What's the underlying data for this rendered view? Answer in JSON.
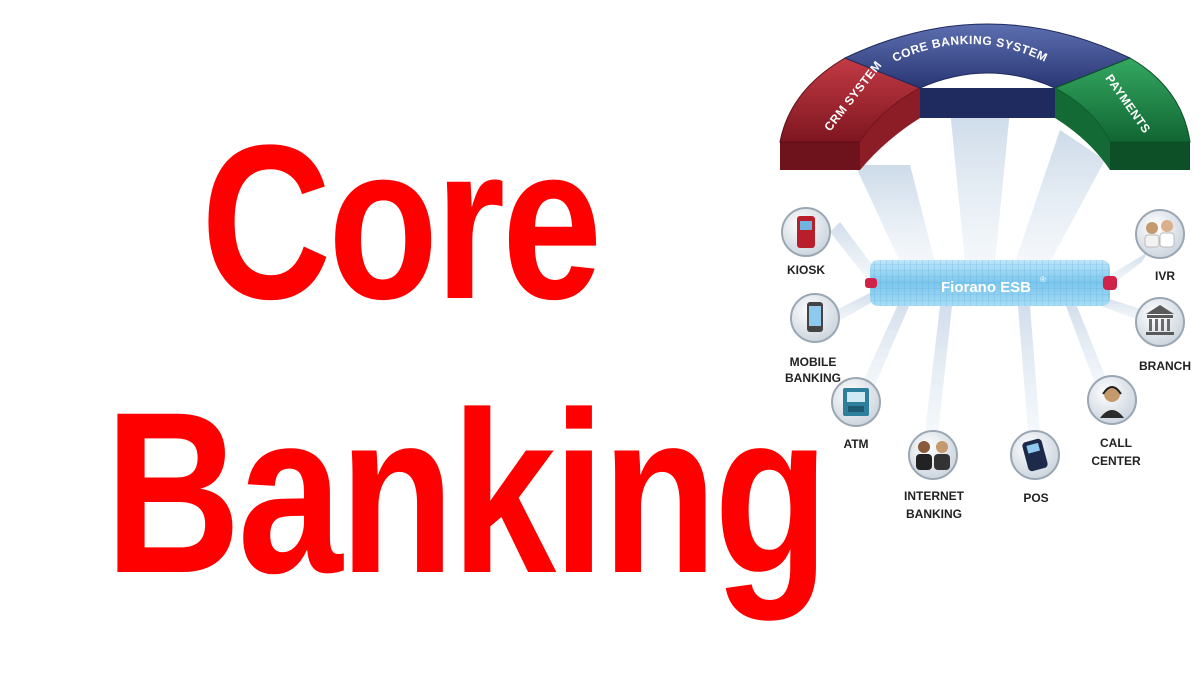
{
  "headline": {
    "line1": "Core",
    "line2": "Banking"
  },
  "diagram": {
    "arch": {
      "left": "CRM SYSTEM",
      "center": "CORE BANKING SYSTEM",
      "right": "PAYMENTS"
    },
    "bus": "Fiorano ESB",
    "bus_mark": "®",
    "nodes": {
      "kiosk": "KIOSK",
      "mobile_1": "MOBILE",
      "mobile_2": "BANKING",
      "atm": "ATM",
      "internet_1": "INTERNET",
      "internet_2": "BANKING",
      "pos": "POS",
      "call_1": "CALL",
      "call_2": "CENTER",
      "branch": "BRANCH",
      "ivr": "IVR"
    }
  },
  "colors": {
    "headline": "#ff0000",
    "crm": "#a3232f",
    "core": "#2f3f86",
    "payments": "#1e8a48",
    "bus": "#8fd0f0"
  }
}
